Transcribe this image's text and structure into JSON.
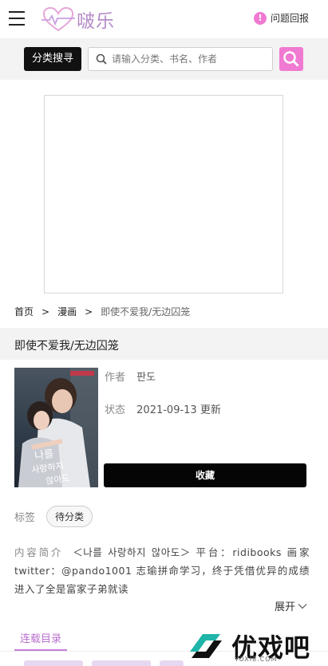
{
  "header": {
    "logo_text": "啵乐",
    "report_label": "问题回报",
    "report_badge": "!"
  },
  "search": {
    "category_button": "分类搜寻",
    "placeholder": "请输入分类、书名、作者",
    "value": ""
  },
  "breadcrumb": {
    "home": "首页",
    "separator": ">",
    "section": "漫画",
    "current": "即使不爱我/无边囚笼"
  },
  "book": {
    "title": "即使不爱我/无边囚笼",
    "author_label": "作者",
    "author": "판도",
    "status_label": "状态",
    "status": "2021-09-13 更新",
    "favorite_button": "收藏",
    "tags_label": "标签",
    "tags": [
      "待分类"
    ],
    "intro_label": "内容简介",
    "intro": "＜나를 사랑하지 않아도＞ 平台：ridibooks 画家twitter：@pando1001 志瑜拼命学习，终于凭借优异的成绩进入了全是富家子弟就读",
    "expand_label": "展开"
  },
  "tabs": {
    "active": "连载目录"
  },
  "watermark": {
    "text": "优戏吧",
    "sub": "YOXI8.COM"
  },
  "colors": {
    "accent": "#f07ad2",
    "tab_accent": "#b870d0",
    "button_dark": "#111111"
  }
}
